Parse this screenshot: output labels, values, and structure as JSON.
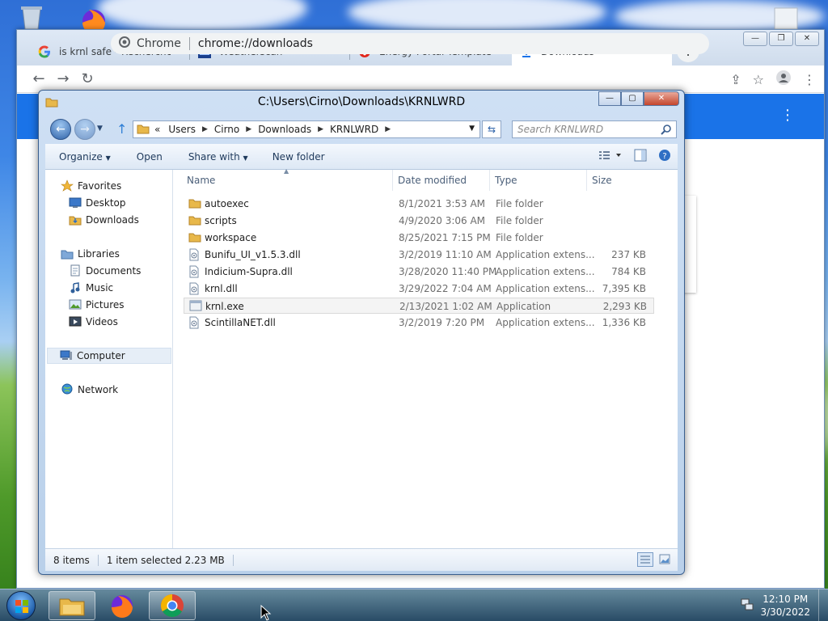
{
  "colors": {
    "chrome_accent": "#1a73e8",
    "explorer_frame": "#b9d0ea",
    "selection_bg": "#f4f4f4"
  },
  "chrome": {
    "tabs": [
      {
        "title": "is krnl safe - Recherche G",
        "icon": "google-icon"
      },
      {
        "title": "Weatherscan",
        "icon": "weatherscan-icon"
      },
      {
        "title": "Energy Portal Template: V",
        "icon": "opera-icon"
      },
      {
        "title": "Downloads",
        "icon": "download-icon",
        "active": true
      }
    ],
    "omnibox": {
      "label": "Chrome",
      "url": "chrome://downloads"
    }
  },
  "explorer": {
    "title": "C:\\Users\\Cirno\\Downloads\\KRNLWRD",
    "breadcrumb": {
      "overflow": "«",
      "parts": [
        "Users",
        "Cirno",
        "Downloads",
        "KRNLWRD"
      ]
    },
    "search_placeholder": "Search KRNLWRD",
    "commands": {
      "organize": "Organize",
      "open": "Open",
      "share_with": "Share with",
      "new_folder": "New folder"
    },
    "nav": {
      "favorites": "Favorites",
      "desktop": "Desktop",
      "downloads": "Downloads",
      "libraries": "Libraries",
      "documents": "Documents",
      "music": "Music",
      "pictures": "Pictures",
      "videos": "Videos",
      "computer": "Computer",
      "network": "Network"
    },
    "columns": {
      "name": "Name",
      "date": "Date modified",
      "type": "Type",
      "size": "Size"
    },
    "files": [
      {
        "name": "autoexec",
        "date": "8/1/2021 3:53 AM",
        "type": "File folder",
        "size": "",
        "kind": "folder"
      },
      {
        "name": "scripts",
        "date": "4/9/2020 3:06 AM",
        "type": "File folder",
        "size": "",
        "kind": "folder"
      },
      {
        "name": "workspace",
        "date": "8/25/2021 7:15 PM",
        "type": "File folder",
        "size": "",
        "kind": "folder"
      },
      {
        "name": "Bunifu_UI_v1.5.3.dll",
        "date": "3/2/2019 11:10 AM",
        "type": "Application extens...",
        "size": "237 KB",
        "kind": "dll"
      },
      {
        "name": "Indicium-Supra.dll",
        "date": "3/28/2020 11:40 PM",
        "type": "Application extens...",
        "size": "784 KB",
        "kind": "dll"
      },
      {
        "name": "krnl.dll",
        "date": "3/29/2022 7:04 AM",
        "type": "Application extens...",
        "size": "7,395 KB",
        "kind": "dll"
      },
      {
        "name": "krnl.exe",
        "date": "2/13/2021 1:02 AM",
        "type": "Application",
        "size": "2,293 KB",
        "kind": "exe",
        "selected": true
      },
      {
        "name": "ScintillaNET.dll",
        "date": "3/2/2019 7:20 PM",
        "type": "Application extens...",
        "size": "1,336 KB",
        "kind": "dll"
      }
    ],
    "status": {
      "count": "8 items",
      "selection": "1 item selected  2.23 MB"
    }
  },
  "taskbar": {
    "clock_time": "12:10 PM",
    "clock_date": "3/30/2022"
  }
}
